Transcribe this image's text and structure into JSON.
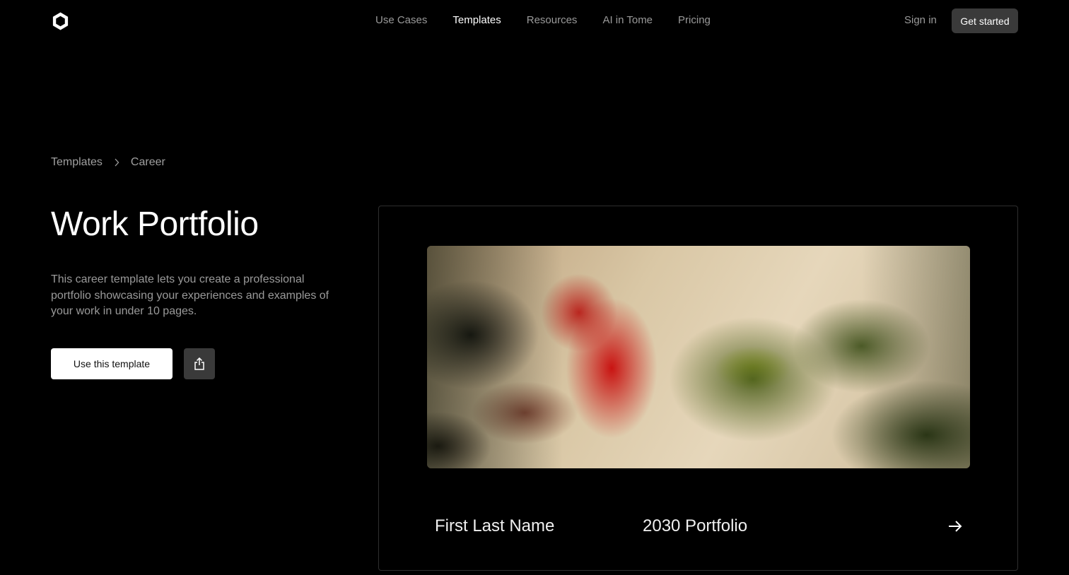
{
  "nav": {
    "items": [
      "Use Cases",
      "Templates",
      "Resources",
      "AI in Tome",
      "Pricing"
    ],
    "active": "Templates",
    "sign_in": "Sign in",
    "get_started": "Get started"
  },
  "breadcrumb": {
    "root": "Templates",
    "current": "Career"
  },
  "page": {
    "title": "Work Portfolio",
    "description": "This career template lets you create a professional portfolio showcasing your experiences and examples of your work in under 10 pages.",
    "use_template": "Use this template"
  },
  "preview": {
    "name": "First Last Name",
    "year_title": "2030 Portfolio"
  },
  "icons": {
    "logo": "tome-logo-icon",
    "breadcrumb_separator": "chevron-right-icon",
    "share": "share-icon",
    "next": "arrow-right-icon"
  }
}
